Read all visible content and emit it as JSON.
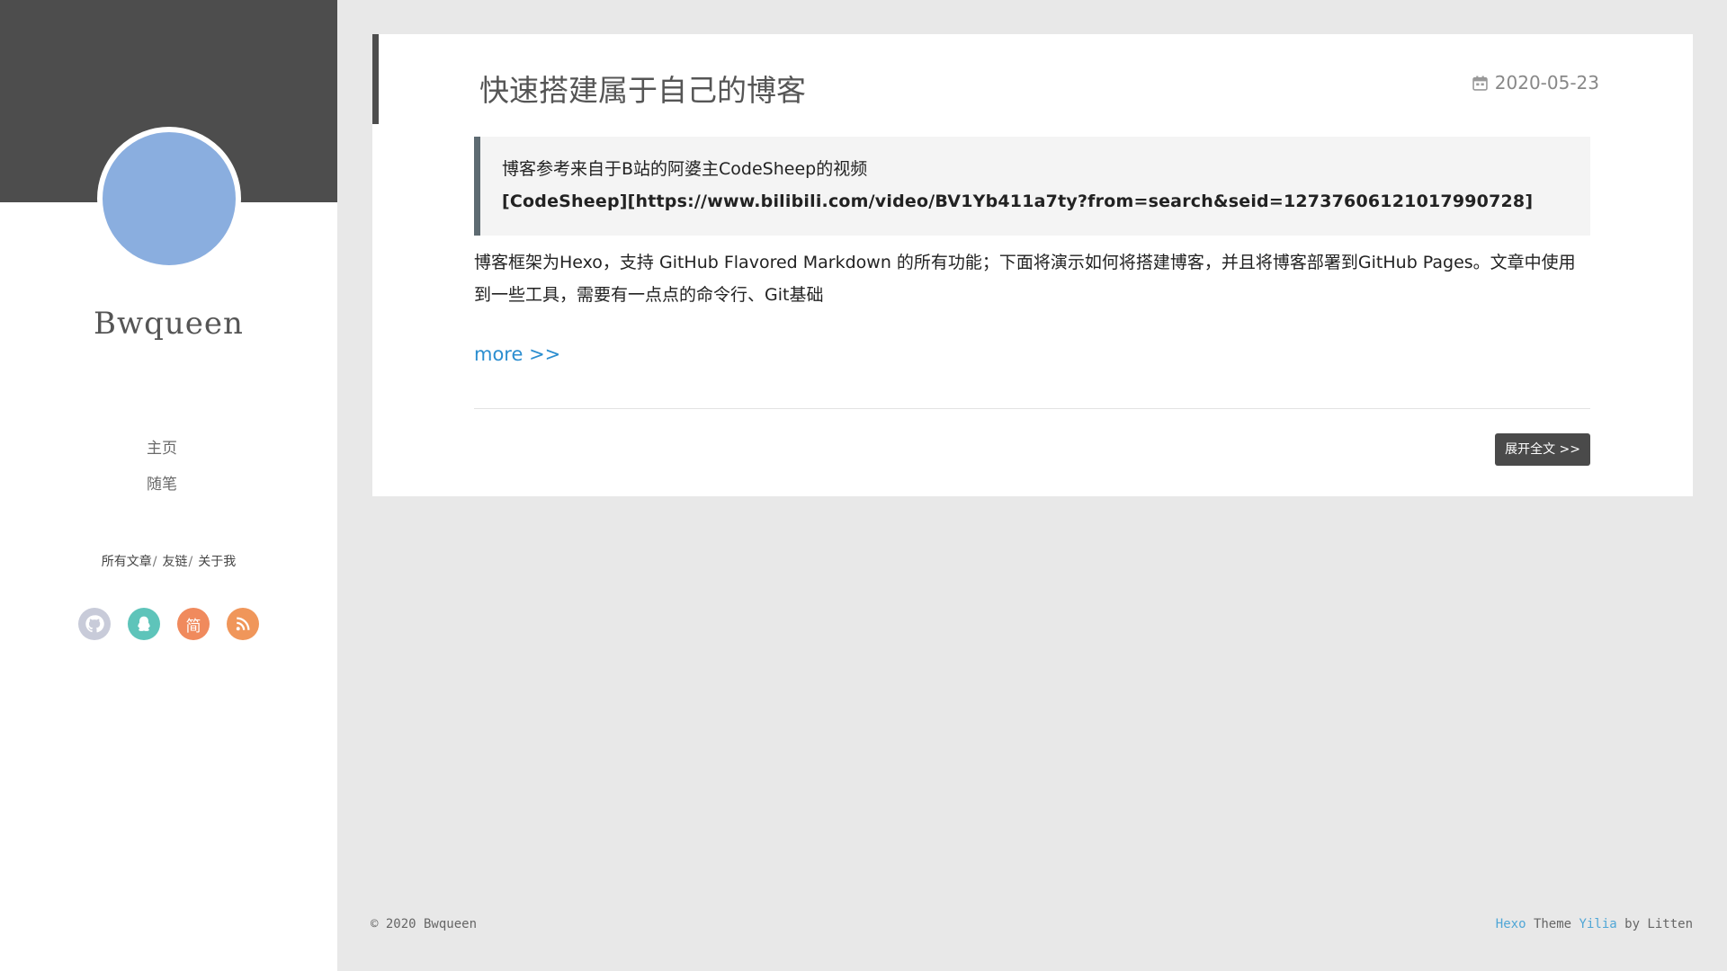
{
  "sidebar": {
    "site_name": "Bwqueen",
    "nav": [
      {
        "label": "主页"
      },
      {
        "label": "随笔"
      }
    ],
    "sub_nav": [
      {
        "label": "所有文章"
      },
      {
        "label": "友链"
      },
      {
        "label": "关于我"
      }
    ],
    "sub_nav_separator": "/",
    "social": [
      {
        "name": "github-icon",
        "color": "#c8cbd9"
      },
      {
        "name": "qq-icon",
        "color": "#5ec4ba"
      },
      {
        "name": "jianshu-icon",
        "label": "简",
        "color": "#f08a5d"
      },
      {
        "name": "rss-icon",
        "color": "#f0965a"
      }
    ]
  },
  "article": {
    "title": "快速搭建属于自己的博客",
    "date": "2020-05-23",
    "quote_line1": "博客参考来自于B站的阿婆主CodeSheep的视频",
    "quote_line2": "[CodeSheep][https://www.bilibili.com/video/BV1Yb411a7ty?from=search&seid=12737606121017990728]",
    "body": " 博客框架为Hexo，支持 GitHub Flavored Markdown 的所有功能；下面将演示如何将搭建博客，并且将博客部署到GitHub Pages。文章中使用到一些工具，需要有一点点的命令行、Git基础",
    "more_label": "more >>",
    "expand_label": "展开全文 >>"
  },
  "footer": {
    "copyright": "© 2020 Bwqueen",
    "hexo": "Hexo",
    "theme_word": "Theme",
    "yilia": "Yilia",
    "by": "by Litten"
  },
  "colors": {
    "sidebar_header": "#4d4d4d",
    "avatar": "#8aaedf",
    "link": "#2b8ed0",
    "background": "#e8e8e8"
  }
}
